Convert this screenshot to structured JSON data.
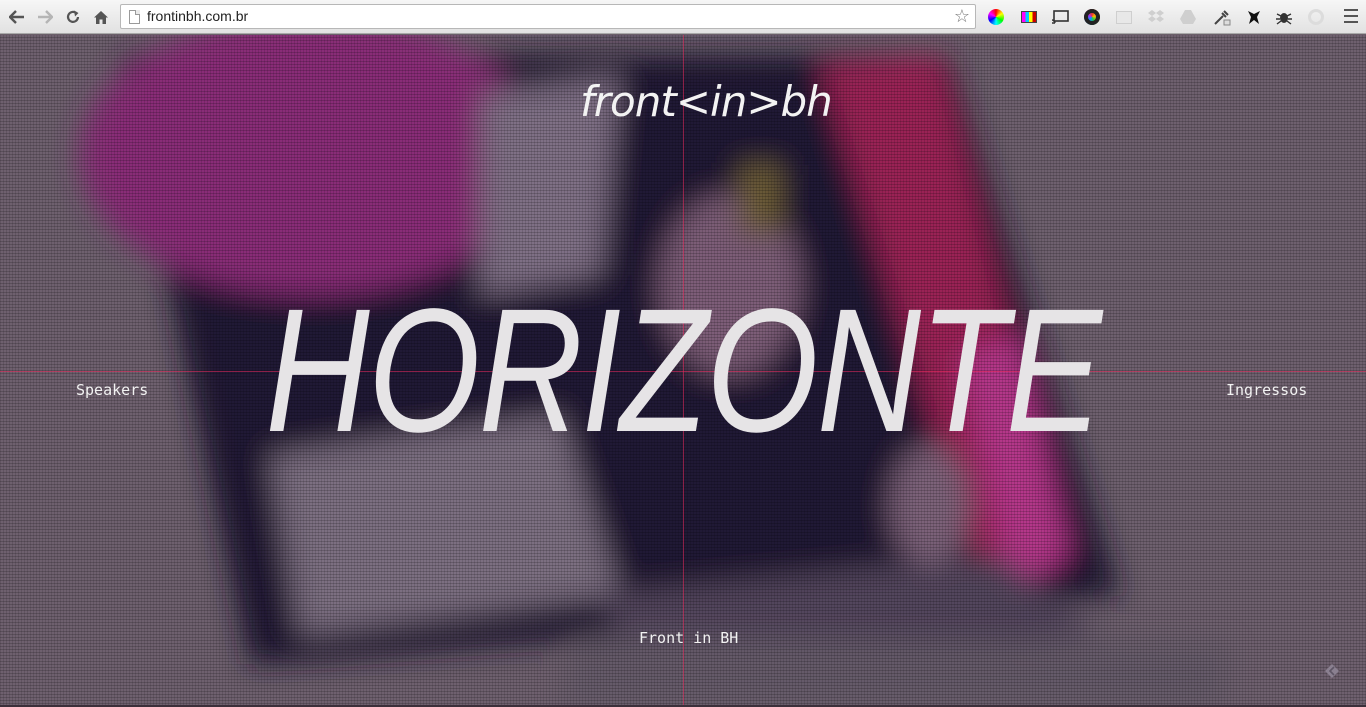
{
  "browser": {
    "url": "frontinbh.com.br",
    "nav": {
      "back_icon": "←",
      "forward_icon": "→",
      "reload_icon": "↻",
      "home_icon": "⌂"
    },
    "star_icon": "☆",
    "extensions": [
      "color-wheel-icon",
      "rgb-bars-icon",
      "cast-icon",
      "color-picker-ring-icon",
      "blank-doc-icon",
      "dropbox-icon",
      "drive-icon",
      "eyedropper-icon",
      "ninja-icon",
      "bug-icon",
      "refresh-circle-icon"
    ]
  },
  "page": {
    "logo": "front<in>bh",
    "headline": "HORIZONTE",
    "nav_left": "Speakers",
    "nav_right": "Ingressos",
    "footer": "Front in BH"
  },
  "colors": {
    "text": "#f2f2f2",
    "guide_line": "#e6285a",
    "magenta": "#b0236f"
  }
}
